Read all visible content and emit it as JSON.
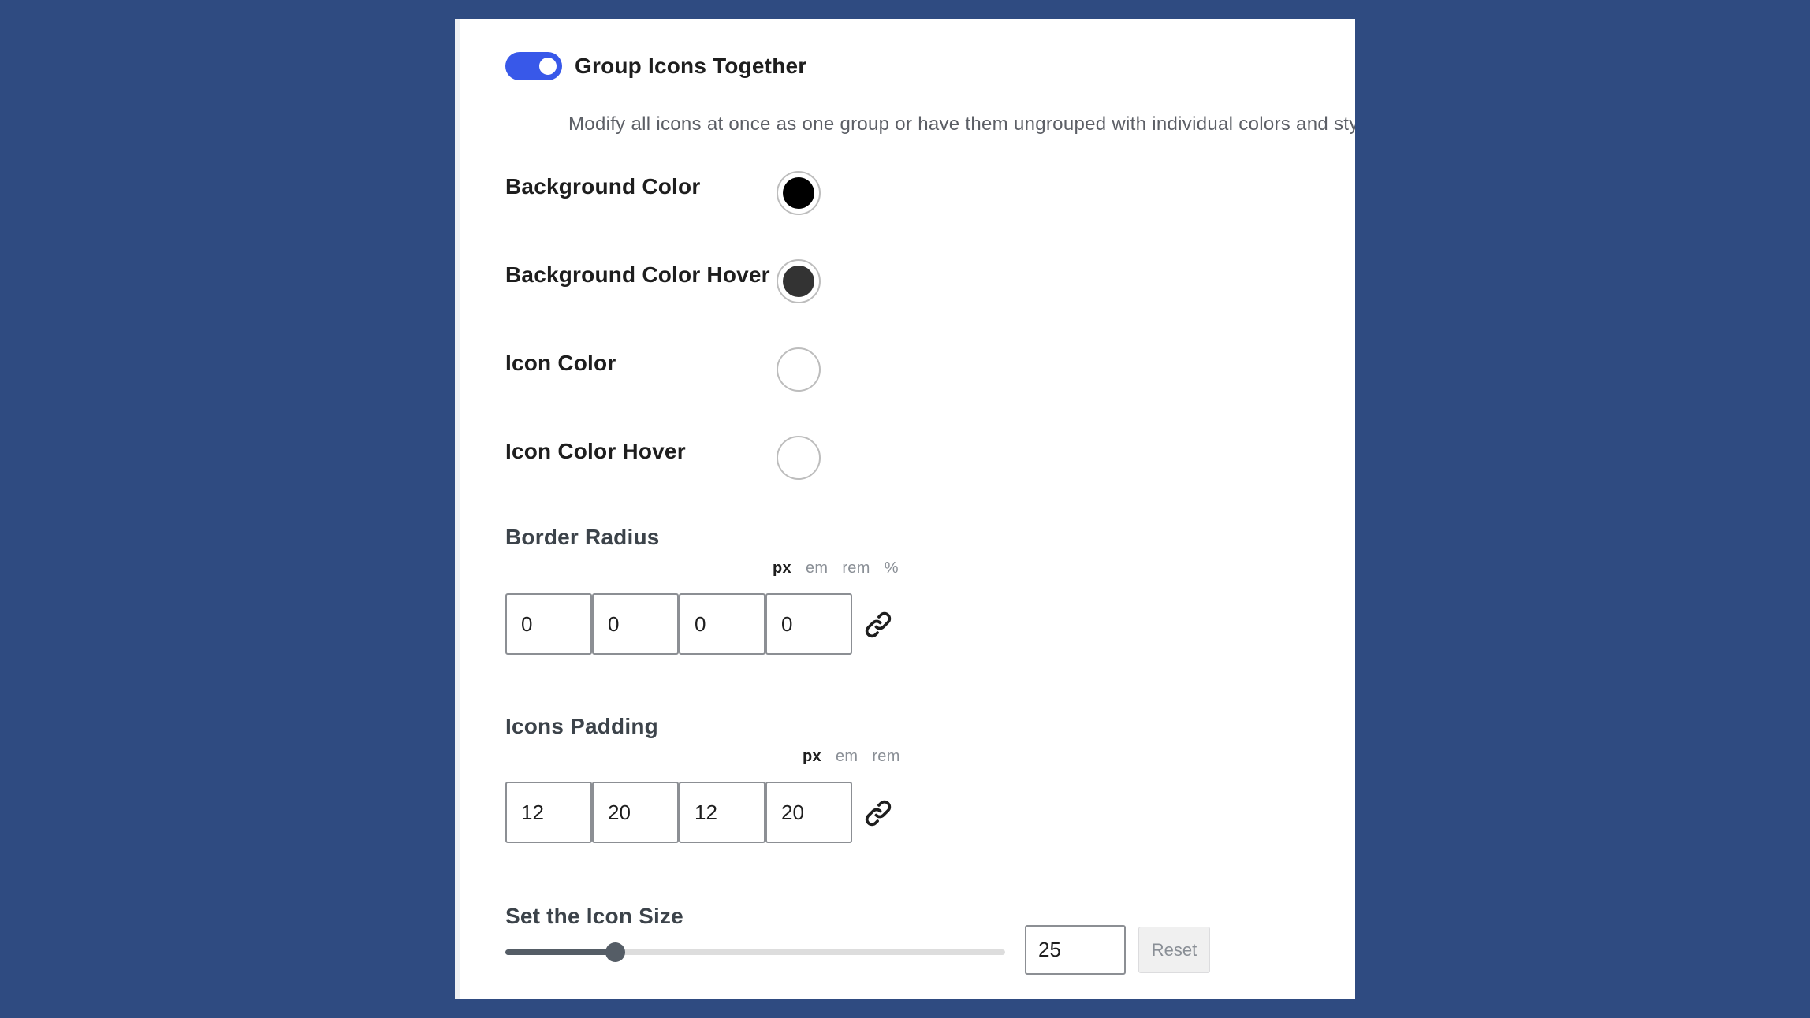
{
  "group_toggle": {
    "label": "Group Icons Together",
    "enabled": true,
    "help": "Modify all icons at once as one group or have them ungrouped with individual colors and styles."
  },
  "colors": [
    {
      "label": "Background Color",
      "value": "#000000"
    },
    {
      "label": "Background Color Hover",
      "value": "#333333"
    },
    {
      "label": "Icon Color",
      "value": "#ffffff"
    },
    {
      "label": "Icon Color Hover",
      "value": "#ffffff"
    }
  ],
  "border_radius": {
    "title": "Border Radius",
    "units": [
      "px",
      "em",
      "rem",
      "%"
    ],
    "active_unit": "px",
    "values": [
      "0",
      "0",
      "0",
      "0"
    ]
  },
  "icons_padding": {
    "title": "Icons Padding",
    "units": [
      "px",
      "em",
      "rem"
    ],
    "active_unit": "px",
    "values": [
      "12",
      "20",
      "12",
      "20"
    ]
  },
  "icon_size": {
    "title": "Set the Icon Size",
    "value": "25",
    "fraction": 0.22,
    "reset_label": "Reset"
  },
  "theme": {
    "accent": "#3858e9",
    "page_bg": "#2f4b81"
  }
}
